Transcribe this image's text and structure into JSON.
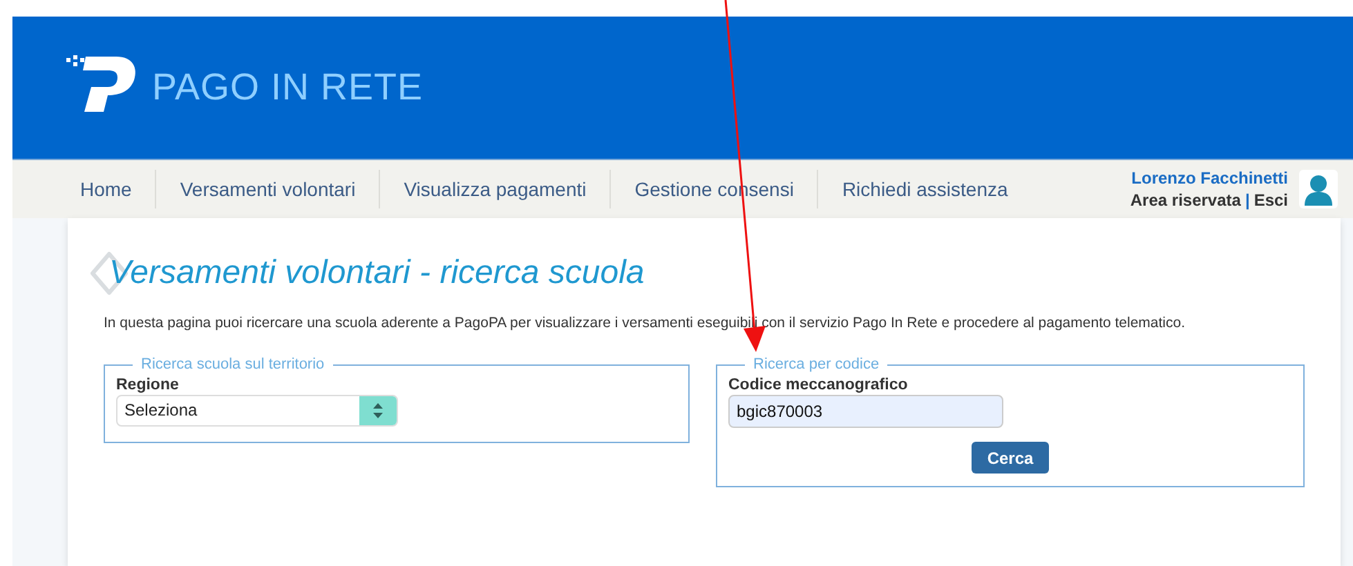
{
  "header": {
    "logo_text": "PAGO IN RETE"
  },
  "nav": {
    "items": [
      {
        "label": "Home"
      },
      {
        "label": "Versamenti volontari"
      },
      {
        "label": "Visualizza pagamenti"
      },
      {
        "label": "Gestione consensi"
      },
      {
        "label": "Richiedi assistenza"
      }
    ],
    "user": {
      "name": "Lorenzo Facchinetti",
      "area_link": "Area riservata",
      "separator": "|",
      "logout": "Esci"
    }
  },
  "page": {
    "title": "Versamenti volontari - ricerca scuola",
    "description": "In questa pagina puoi ricercare una scuola aderente a PagoPA per visualizzare i versamenti eseguibili con il servizio Pago In Rete e procedere al pagamento telematico.",
    "territory_search": {
      "legend": "Ricerca scuola sul territorio",
      "label": "Regione",
      "value": "Seleziona"
    },
    "code_search": {
      "legend": "Ricerca per codice",
      "label": "Codice meccanografico",
      "value": "bgic870003",
      "button": "Cerca"
    }
  }
}
